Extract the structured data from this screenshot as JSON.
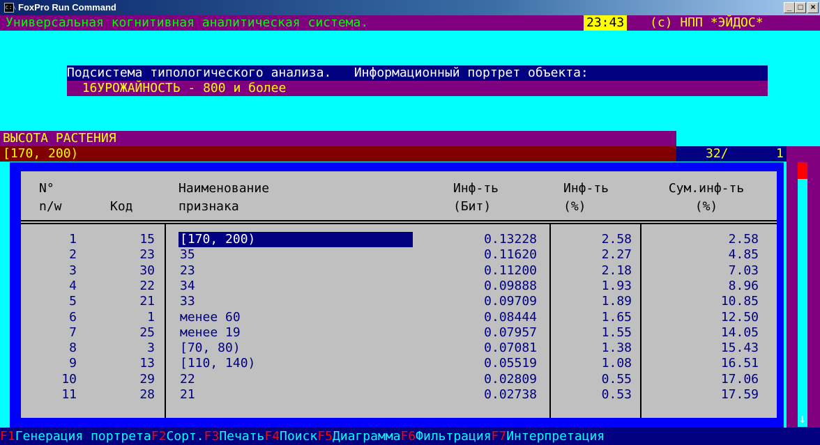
{
  "window": {
    "title": "FoxPro Run Command",
    "icon": "console-icon",
    "icon_glyph": "c:\\",
    "min_label": "_",
    "max_label": "□",
    "close_label": "×"
  },
  "header": {
    "system_title": "Универсальная когнитивная аналитическая система.",
    "time": "23:43",
    "copyright": "(c) НПП *ЭЙДОС*"
  },
  "subheader": {
    "subsystem": "Подсистема типологического анализа.",
    "portrait_label": "Информационный портрет объекта:",
    "object_number": "16",
    "object_name": "УРОЖАЙНОСТЬ - 800 и более"
  },
  "group": {
    "scale_name": "ВЫСОТА РАСТЕНИЯ",
    "gradation": "[170, 200)",
    "position": "32/",
    "page": "1"
  },
  "table": {
    "headers": {
      "num_1": "N°",
      "num_2": "n/w",
      "code": "Код",
      "name_1": "Наименование",
      "name_2": "признака",
      "info_bit_1": "Инф-ть",
      "info_bit_2": "(Бит)",
      "info_pct_1": "Инф-ть",
      "info_pct_2": "(%)",
      "sum_1": "Сум.инф-ть",
      "sum_2": "(%)"
    },
    "rows": [
      {
        "n": "1",
        "code": "15",
        "name": "[170, 200)",
        "bit": "0.13228",
        "pct": "2.58",
        "sum": "2.58"
      },
      {
        "n": "2",
        "code": "23",
        "name": "35",
        "bit": "0.11620",
        "pct": "2.27",
        "sum": "4.85"
      },
      {
        "n": "3",
        "code": "30",
        "name": "23",
        "bit": "0.11200",
        "pct": "2.18",
        "sum": "7.03"
      },
      {
        "n": "4",
        "code": "22",
        "name": "34",
        "bit": "0.09888",
        "pct": "1.93",
        "sum": "8.96"
      },
      {
        "n": "5",
        "code": "21",
        "name": "33",
        "bit": "0.09709",
        "pct": "1.89",
        "sum": "10.85"
      },
      {
        "n": "6",
        "code": "1",
        "name": "менее 60",
        "bit": "0.08444",
        "pct": "1.65",
        "sum": "12.50"
      },
      {
        "n": "7",
        "code": "25",
        "name": "менее 19",
        "bit": "0.07957",
        "pct": "1.55",
        "sum": "14.05"
      },
      {
        "n": "8",
        "code": "3",
        "name": "[70, 80)",
        "bit": "0.07081",
        "pct": "1.38",
        "sum": "15.43"
      },
      {
        "n": "9",
        "code": "13",
        "name": "[110, 140)",
        "bit": "0.05519",
        "pct": "1.08",
        "sum": "16.51"
      },
      {
        "n": "10",
        "code": "29",
        "name": "22",
        "bit": "0.02809",
        "pct": "0.55",
        "sum": "17.06"
      },
      {
        "n": "11",
        "code": "28",
        "name": "21",
        "bit": "0.02738",
        "pct": "0.53",
        "sum": "17.59"
      }
    ]
  },
  "scrollbar": {
    "arrow": "↓"
  },
  "footer": {
    "keys": [
      {
        "key": "F1",
        "label": "Генерация портрета"
      },
      {
        "key": "F2",
        "label": "Сорт."
      },
      {
        "key": "F3",
        "label": "Печать"
      },
      {
        "key": "F4",
        "label": "Поиск"
      },
      {
        "key": "F5",
        "label": "Диаграмма"
      },
      {
        "key": "F6",
        "label": "Фильтрация"
      },
      {
        "key": "F7",
        "label": "Интерпретация"
      }
    ]
  },
  "colors": {
    "background": "#00ffff",
    "header_bar": "#800080",
    "title_text": "#00ff00",
    "accent_text": "#ffff00",
    "table_frame": "#0000ff",
    "table_panel": "#c0c0c0",
    "table_text": "#000080",
    "footer_bar": "#000080",
    "footer_key": "#ff0000",
    "footer_text": "#00ffff"
  }
}
